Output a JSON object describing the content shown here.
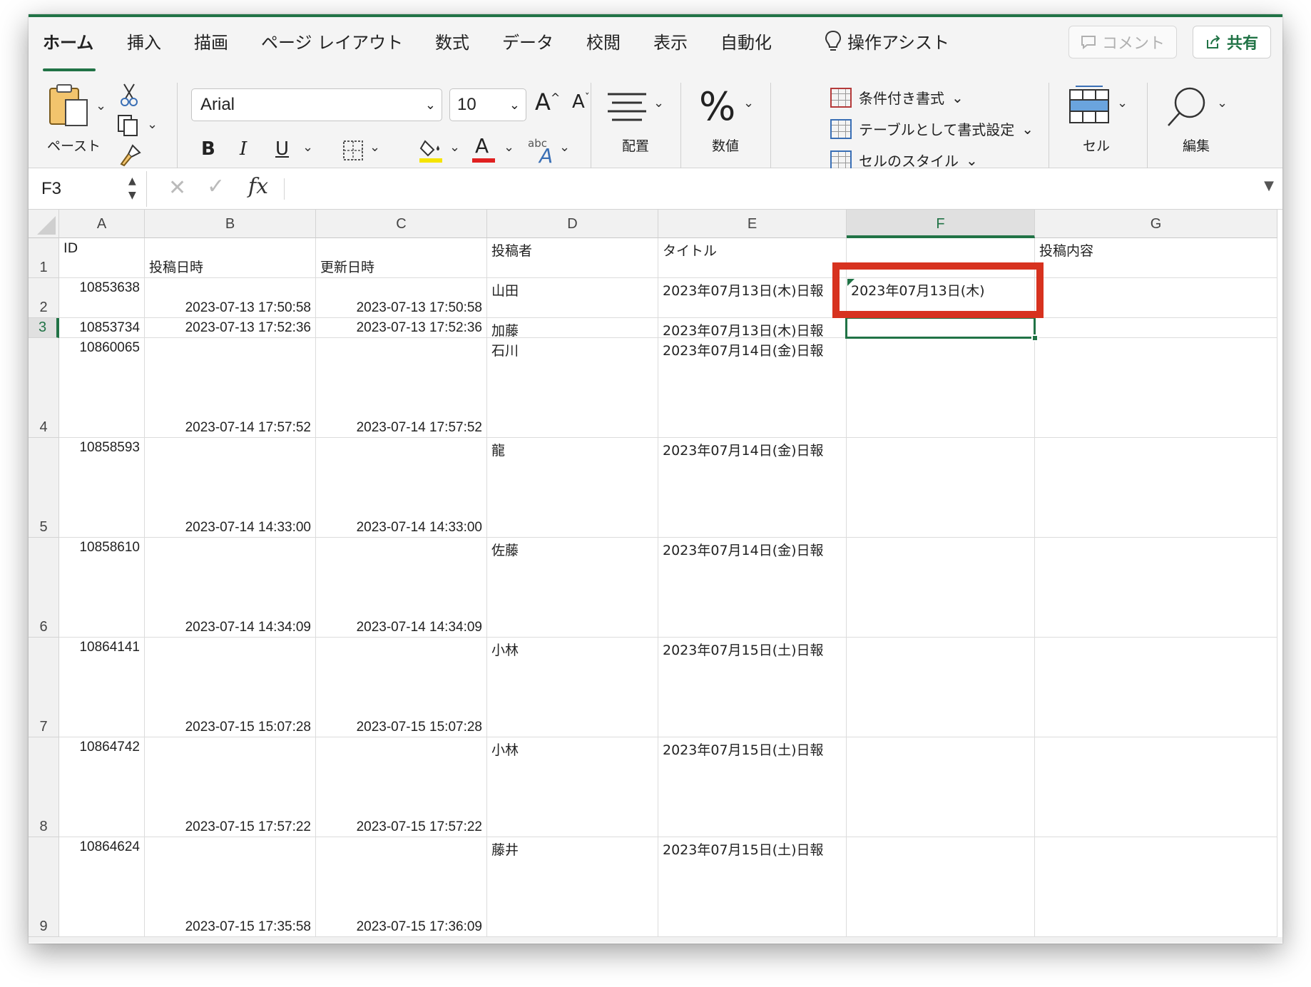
{
  "ribbon": {
    "tabs": [
      "ホーム",
      "挿入",
      "描画",
      "ページ レイアウト",
      "数式",
      "データ",
      "校閲",
      "表示",
      "自動化"
    ],
    "assist_label": "操作アシスト",
    "comment_label": "コメント",
    "share_label": "共有",
    "paste_label": "ペースト",
    "font_name": "Arial",
    "font_size": "10",
    "bold": "B",
    "italic": "I",
    "underline": "U",
    "grow_font": "A",
    "shrink_font": "A",
    "font_color_glyph": "A",
    "abc_glyph": "abc",
    "alignment_label": "配置",
    "number_label": "数値",
    "percent_glyph": "%",
    "conditional_format": "条件付き書式",
    "format_as_table": "テーブルとして書式設定",
    "cell_styles": "セルのスタイル",
    "cells_label": "セル",
    "editing_label": "編集",
    "colors": {
      "accent": "#217346",
      "fill_yellow": "#f5e400",
      "font_red": "#e02020"
    }
  },
  "formula_bar": {
    "name_box": "F3",
    "fx": "fx",
    "content": ""
  },
  "sheet": {
    "columns": [
      "A",
      "B",
      "C",
      "D",
      "E",
      "F",
      "G"
    ],
    "selected_column": "F",
    "selected_row": "3",
    "header_row": {
      "row": "1",
      "A": "ID",
      "B": "投稿日時",
      "C": "更新日時",
      "D": "投稿者",
      "E": "タイトル",
      "F": "",
      "G": "投稿内容"
    },
    "rows": [
      {
        "row": "2",
        "A": "10853638",
        "B": "2023-07-13 17:50:58",
        "C": "2023-07-13 17:50:58",
        "D": "山田",
        "E": "2023年07月13日(木)日報",
        "F": "2023年07月13日(木)",
        "G": ""
      },
      {
        "row": "3",
        "A": "10853734",
        "B": "2023-07-13 17:52:36",
        "C": "2023-07-13 17:52:36",
        "D": "加藤",
        "E": "2023年07月13日(木)日報",
        "F": "",
        "G": ""
      },
      {
        "row": "4",
        "A": "10860065",
        "B": "2023-07-14 17:57:52",
        "C": "2023-07-14 17:57:52",
        "D": "石川",
        "E": "2023年07月14日(金)日報",
        "F": "",
        "G": ""
      },
      {
        "row": "5",
        "A": "10858593",
        "B": "2023-07-14 14:33:00",
        "C": "2023-07-14 14:33:00",
        "D": "龍",
        "E": "2023年07月14日(金)日報",
        "F": "",
        "G": ""
      },
      {
        "row": "6",
        "A": "10858610",
        "B": "2023-07-14 14:34:09",
        "C": "2023-07-14 14:34:09",
        "D": "佐藤",
        "E": "2023年07月14日(金)日報",
        "F": "",
        "G": ""
      },
      {
        "row": "7",
        "A": "10864141",
        "B": "2023-07-15 15:07:28",
        "C": "2023-07-15 15:07:28",
        "D": "小林",
        "E": "2023年07月15日(土)日報",
        "F": "",
        "G": ""
      },
      {
        "row": "8",
        "A": "10864742",
        "B": "2023-07-15 17:57:22",
        "C": "2023-07-15 17:57:22",
        "D": "小林",
        "E": "2023年07月15日(土)日報",
        "F": "",
        "G": ""
      },
      {
        "row": "9",
        "A": "10864624",
        "B": "2023-07-15 17:35:58",
        "C": "2023-07-15 17:36:09",
        "D": "藤井",
        "E": "2023年07月15日(土)日報",
        "F": "",
        "G": ""
      }
    ],
    "highlight_color": "#d7321f"
  }
}
